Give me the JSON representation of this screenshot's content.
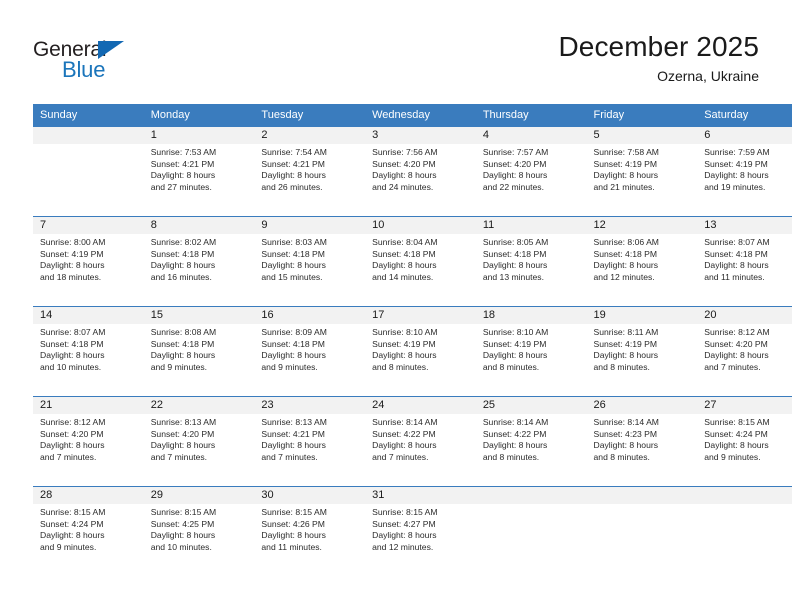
{
  "brand": {
    "name_part1": "General",
    "name_part2": "Blue",
    "triangle_icon": "blue-triangle-icon",
    "color_dark": "#231f20",
    "color_blue": "#1b75bb"
  },
  "header": {
    "title": "December 2025",
    "location": "Ozerna, Ukraine"
  },
  "theme": {
    "header_blue": "#3a7cbe",
    "band_gray": "#f2f2f2",
    "text": "#1a1a1a"
  },
  "weekday_headers": [
    "Sunday",
    "Monday",
    "Tuesday",
    "Wednesday",
    "Thursday",
    "Friday",
    "Saturday"
  ],
  "weeks": [
    [
      {
        "day": "",
        "sunrise": "",
        "sunset": "",
        "daylight1": "",
        "daylight2": ""
      },
      {
        "day": "1",
        "sunrise": "Sunrise: 7:53 AM",
        "sunset": "Sunset: 4:21 PM",
        "daylight1": "Daylight: 8 hours",
        "daylight2": "and 27 minutes."
      },
      {
        "day": "2",
        "sunrise": "Sunrise: 7:54 AM",
        "sunset": "Sunset: 4:21 PM",
        "daylight1": "Daylight: 8 hours",
        "daylight2": "and 26 minutes."
      },
      {
        "day": "3",
        "sunrise": "Sunrise: 7:56 AM",
        "sunset": "Sunset: 4:20 PM",
        "daylight1": "Daylight: 8 hours",
        "daylight2": "and 24 minutes."
      },
      {
        "day": "4",
        "sunrise": "Sunrise: 7:57 AM",
        "sunset": "Sunset: 4:20 PM",
        "daylight1": "Daylight: 8 hours",
        "daylight2": "and 22 minutes."
      },
      {
        "day": "5",
        "sunrise": "Sunrise: 7:58 AM",
        "sunset": "Sunset: 4:19 PM",
        "daylight1": "Daylight: 8 hours",
        "daylight2": "and 21 minutes."
      },
      {
        "day": "6",
        "sunrise": "Sunrise: 7:59 AM",
        "sunset": "Sunset: 4:19 PM",
        "daylight1": "Daylight: 8 hours",
        "daylight2": "and 19 minutes."
      }
    ],
    [
      {
        "day": "7",
        "sunrise": "Sunrise: 8:00 AM",
        "sunset": "Sunset: 4:19 PM",
        "daylight1": "Daylight: 8 hours",
        "daylight2": "and 18 minutes."
      },
      {
        "day": "8",
        "sunrise": "Sunrise: 8:02 AM",
        "sunset": "Sunset: 4:18 PM",
        "daylight1": "Daylight: 8 hours",
        "daylight2": "and 16 minutes."
      },
      {
        "day": "9",
        "sunrise": "Sunrise: 8:03 AM",
        "sunset": "Sunset: 4:18 PM",
        "daylight1": "Daylight: 8 hours",
        "daylight2": "and 15 minutes."
      },
      {
        "day": "10",
        "sunrise": "Sunrise: 8:04 AM",
        "sunset": "Sunset: 4:18 PM",
        "daylight1": "Daylight: 8 hours",
        "daylight2": "and 14 minutes."
      },
      {
        "day": "11",
        "sunrise": "Sunrise: 8:05 AM",
        "sunset": "Sunset: 4:18 PM",
        "daylight1": "Daylight: 8 hours",
        "daylight2": "and 13 minutes."
      },
      {
        "day": "12",
        "sunrise": "Sunrise: 8:06 AM",
        "sunset": "Sunset: 4:18 PM",
        "daylight1": "Daylight: 8 hours",
        "daylight2": "and 12 minutes."
      },
      {
        "day": "13",
        "sunrise": "Sunrise: 8:07 AM",
        "sunset": "Sunset: 4:18 PM",
        "daylight1": "Daylight: 8 hours",
        "daylight2": "and 11 minutes."
      }
    ],
    [
      {
        "day": "14",
        "sunrise": "Sunrise: 8:07 AM",
        "sunset": "Sunset: 4:18 PM",
        "daylight1": "Daylight: 8 hours",
        "daylight2": "and 10 minutes."
      },
      {
        "day": "15",
        "sunrise": "Sunrise: 8:08 AM",
        "sunset": "Sunset: 4:18 PM",
        "daylight1": "Daylight: 8 hours",
        "daylight2": "and 9 minutes."
      },
      {
        "day": "16",
        "sunrise": "Sunrise: 8:09 AM",
        "sunset": "Sunset: 4:18 PM",
        "daylight1": "Daylight: 8 hours",
        "daylight2": "and 9 minutes."
      },
      {
        "day": "17",
        "sunrise": "Sunrise: 8:10 AM",
        "sunset": "Sunset: 4:19 PM",
        "daylight1": "Daylight: 8 hours",
        "daylight2": "and 8 minutes."
      },
      {
        "day": "18",
        "sunrise": "Sunrise: 8:10 AM",
        "sunset": "Sunset: 4:19 PM",
        "daylight1": "Daylight: 8 hours",
        "daylight2": "and 8 minutes."
      },
      {
        "day": "19",
        "sunrise": "Sunrise: 8:11 AM",
        "sunset": "Sunset: 4:19 PM",
        "daylight1": "Daylight: 8 hours",
        "daylight2": "and 8 minutes."
      },
      {
        "day": "20",
        "sunrise": "Sunrise: 8:12 AM",
        "sunset": "Sunset: 4:20 PM",
        "daylight1": "Daylight: 8 hours",
        "daylight2": "and 7 minutes."
      }
    ],
    [
      {
        "day": "21",
        "sunrise": "Sunrise: 8:12 AM",
        "sunset": "Sunset: 4:20 PM",
        "daylight1": "Daylight: 8 hours",
        "daylight2": "and 7 minutes."
      },
      {
        "day": "22",
        "sunrise": "Sunrise: 8:13 AM",
        "sunset": "Sunset: 4:20 PM",
        "daylight1": "Daylight: 8 hours",
        "daylight2": "and 7 minutes."
      },
      {
        "day": "23",
        "sunrise": "Sunrise: 8:13 AM",
        "sunset": "Sunset: 4:21 PM",
        "daylight1": "Daylight: 8 hours",
        "daylight2": "and 7 minutes."
      },
      {
        "day": "24",
        "sunrise": "Sunrise: 8:14 AM",
        "sunset": "Sunset: 4:22 PM",
        "daylight1": "Daylight: 8 hours",
        "daylight2": "and 7 minutes."
      },
      {
        "day": "25",
        "sunrise": "Sunrise: 8:14 AM",
        "sunset": "Sunset: 4:22 PM",
        "daylight1": "Daylight: 8 hours",
        "daylight2": "and 8 minutes."
      },
      {
        "day": "26",
        "sunrise": "Sunrise: 8:14 AM",
        "sunset": "Sunset: 4:23 PM",
        "daylight1": "Daylight: 8 hours",
        "daylight2": "and 8 minutes."
      },
      {
        "day": "27",
        "sunrise": "Sunrise: 8:15 AM",
        "sunset": "Sunset: 4:24 PM",
        "daylight1": "Daylight: 8 hours",
        "daylight2": "and 9 minutes."
      }
    ],
    [
      {
        "day": "28",
        "sunrise": "Sunrise: 8:15 AM",
        "sunset": "Sunset: 4:24 PM",
        "daylight1": "Daylight: 8 hours",
        "daylight2": "and 9 minutes."
      },
      {
        "day": "29",
        "sunrise": "Sunrise: 8:15 AM",
        "sunset": "Sunset: 4:25 PM",
        "daylight1": "Daylight: 8 hours",
        "daylight2": "and 10 minutes."
      },
      {
        "day": "30",
        "sunrise": "Sunrise: 8:15 AM",
        "sunset": "Sunset: 4:26 PM",
        "daylight1": "Daylight: 8 hours",
        "daylight2": "and 11 minutes."
      },
      {
        "day": "31",
        "sunrise": "Sunrise: 8:15 AM",
        "sunset": "Sunset: 4:27 PM",
        "daylight1": "Daylight: 8 hours",
        "daylight2": "and 12 minutes."
      },
      {
        "day": "",
        "sunrise": "",
        "sunset": "",
        "daylight1": "",
        "daylight2": ""
      },
      {
        "day": "",
        "sunrise": "",
        "sunset": "",
        "daylight1": "",
        "daylight2": ""
      },
      {
        "day": "",
        "sunrise": "",
        "sunset": "",
        "daylight1": "",
        "daylight2": ""
      }
    ]
  ]
}
